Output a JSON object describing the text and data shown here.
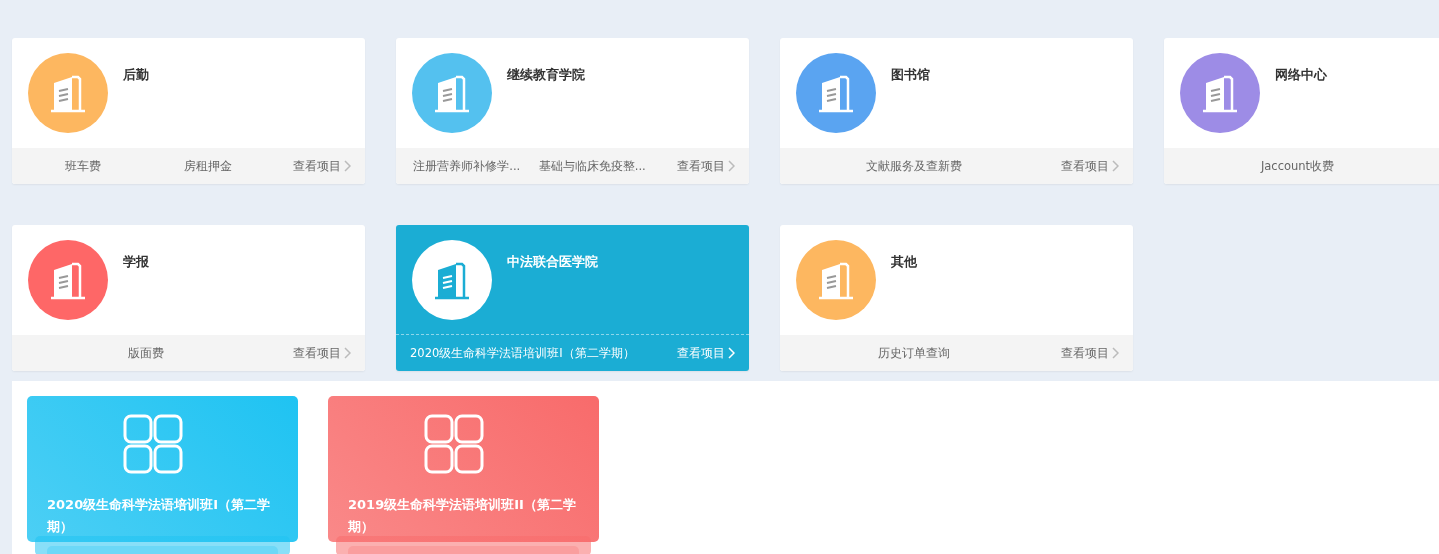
{
  "departments": [
    {
      "title": "后勤",
      "color": "#fdb760",
      "selected": false,
      "items": [
        "班车费",
        "房租押金"
      ],
      "link": "查看项目"
    },
    {
      "title": "继续教育学院",
      "color": "#54c1ef",
      "selected": false,
      "items": [
        "注册营养师补修学...",
        "基础与临床免疫整..."
      ],
      "link": "查看项目"
    },
    {
      "title": "图书馆",
      "color": "#5aa4f1",
      "selected": false,
      "items": [
        "文献服务及查新费"
      ],
      "link": "查看项目"
    },
    {
      "title": "网络中心",
      "color": "#9d8ce6",
      "selected": false,
      "items": [
        "Jaccount收费"
      ]
    },
    {
      "title": "学报",
      "color": "#fe6767",
      "selected": false,
      "items": [
        "版面费"
      ],
      "link": "查看项目"
    },
    {
      "title": "中法联合医学院",
      "color": "#1badd4",
      "selected": true,
      "items": [
        "2020级生命科学法语培训班I（第二学期）"
      ],
      "link": "查看项目"
    },
    {
      "title": "其他",
      "color": "#fdb760",
      "selected": false,
      "items": [
        "历史订单查询"
      ],
      "link": "查看项目"
    }
  ],
  "projects": [
    {
      "title": "2020级生命科学法语培训班I（第二学期）",
      "color": "#1fc3f2"
    },
    {
      "title": "2019级生命科学法语培训班II（第二学期）",
      "color": "#f86b6b"
    }
  ]
}
